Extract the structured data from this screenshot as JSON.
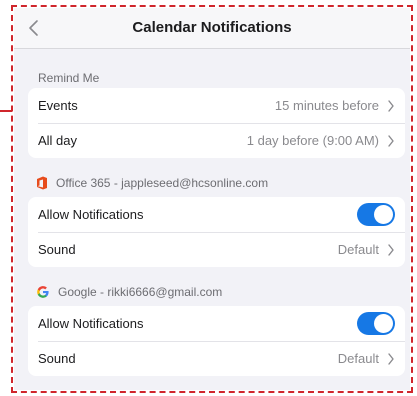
{
  "nav": {
    "title": "Calendar Notifications"
  },
  "remind": {
    "header": "Remind Me",
    "rows": [
      {
        "label": "Events",
        "value": "15 minutes before"
      },
      {
        "label": "All day",
        "value": "1 day before (9:00 AM)"
      }
    ]
  },
  "accounts": [
    {
      "icon": "office-icon",
      "header": "Office 365 - jappleseed@hcsonline.com",
      "notifications_label": "Allow Notifications",
      "notifications_on": true,
      "sound_label": "Sound",
      "sound_value": "Default"
    },
    {
      "icon": "google-icon",
      "header": "Google - rikki6666@gmail.com",
      "notifications_label": "Allow Notifications",
      "notifications_on": true,
      "sound_label": "Sound",
      "sound_value": "Default"
    }
  ],
  "colors": {
    "toggle_on": "#1678e5",
    "annotation_border": "#d0262c",
    "office_icon": "#e74c1c"
  }
}
